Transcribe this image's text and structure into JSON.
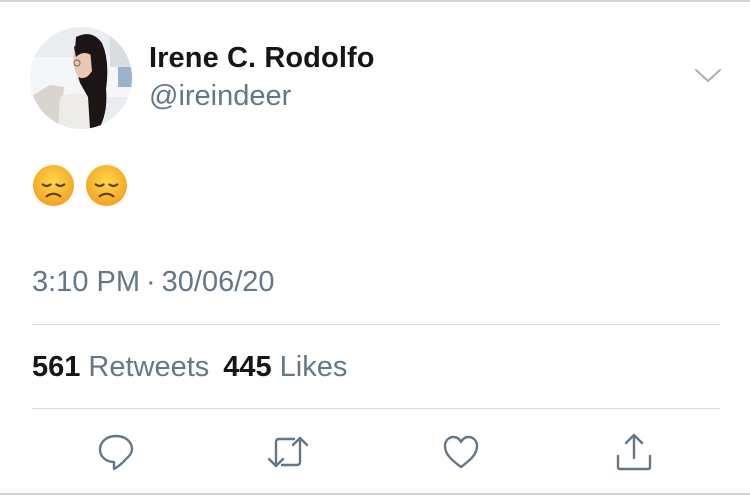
{
  "user": {
    "display_name": "Irene C. Rodolfo",
    "handle": "@ireindeer",
    "avatar": "profile-photo"
  },
  "tweet": {
    "emojis": [
      "disappointed-face",
      "disappointed-face"
    ],
    "time": "3:10 PM",
    "separator": "·",
    "date": "30/06/20"
  },
  "stats": {
    "retweets_count": "561",
    "retweets_label": "Retweets",
    "likes_count": "445",
    "likes_label": "Likes"
  },
  "actions": {
    "reply_icon": "speech-bubble-icon",
    "retweet_icon": "retweet-icon",
    "like_icon": "heart-icon",
    "share_icon": "share-icon"
  },
  "colors": {
    "text_primary": "#14171a",
    "text_secondary": "#657786",
    "icon": "#657786",
    "divider": "#d6dadd",
    "emoji_fill": "#fbb832"
  }
}
